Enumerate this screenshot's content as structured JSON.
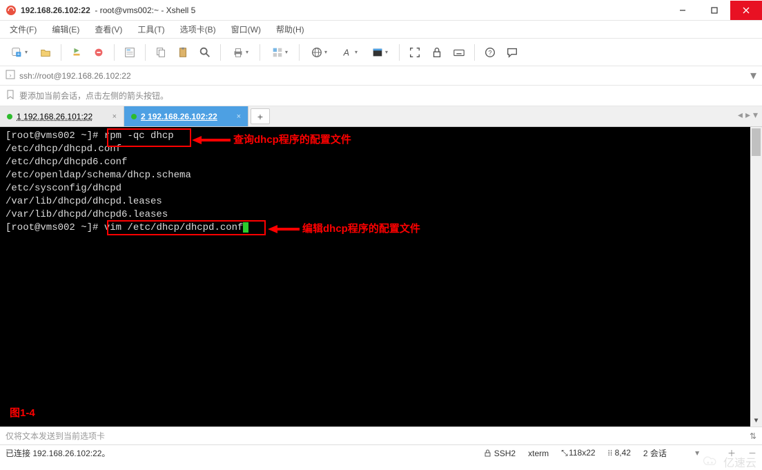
{
  "window": {
    "ip_title": "192.168.26.102:22",
    "app_title_suffix": "root@vms002:~ - Xshell 5"
  },
  "menubar": {
    "file": "文件(F)",
    "edit": "编辑(E)",
    "view": "查看(V)",
    "tools": "工具(T)",
    "tabs": "选项卡(B)",
    "window": "窗口(W)",
    "help": "帮助(H)"
  },
  "addressbar": {
    "url": "ssh://root@192.168.26.102:22"
  },
  "infobar": {
    "hint": "要添加当前会话，点击左侧的箭头按钮。"
  },
  "tabs": {
    "tab1_index": "1",
    "tab1_label": "192.168.26.101:22",
    "tab2_index": "2",
    "tab2_label": "192.168.26.102:22",
    "add": "+"
  },
  "terminal": {
    "prompt1_prefix": "[root@vms002 ~]# ",
    "cmd1": "rpm -qc dhcp",
    "out1": "/etc/dhcp/dhcpd.conf",
    "out2": "/etc/dhcp/dhcpd6.conf",
    "out3": "/etc/openldap/schema/dhcp.schema",
    "out4": "/etc/sysconfig/dhcpd",
    "out5": "/var/lib/dhcpd/dhcpd.leases",
    "out6": "/var/lib/dhcpd/dhcpd6.leases",
    "prompt2_prefix": "[root@vms002 ~]# ",
    "cmd2": "vim /etc/dhcp/dhcpd.conf",
    "annotation1": "查询dhcp程序的配置文件",
    "annotation2": "编辑dhcp程序的配置文件",
    "figure_label": "图1-4"
  },
  "footer": {
    "send_hint": "仅将文本发送到当前选项卡"
  },
  "status": {
    "connected": "已连接 192.168.26.102:22。",
    "ssh": "SSH2",
    "term": "xterm",
    "size": "118x22",
    "pos": "8,42",
    "sessions": "2 会话"
  },
  "watermark": {
    "text": "亿速云"
  }
}
